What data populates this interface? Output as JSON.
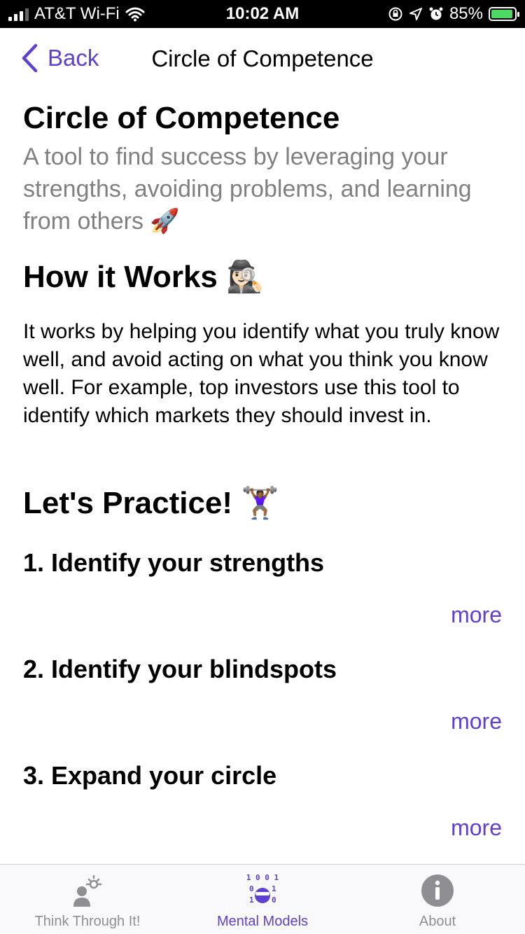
{
  "status_bar": {
    "carrier": "AT&T Wi-Fi",
    "time": "10:02 AM",
    "battery": "85%",
    "icons": [
      "signal-icon",
      "wifi-icon",
      "orientation-lock-icon",
      "location-icon",
      "alarm-icon",
      "battery-icon"
    ]
  },
  "nav": {
    "back_label": "Back",
    "title": "Circle of Competence"
  },
  "content": {
    "title": "Circle of Competence",
    "subtitle": "A tool to find success by leveraging your strengths, avoiding problems, and learning from others 🚀",
    "how_title": "How it Works 🕵🏻‍♀️",
    "how_body": "It works by helping you identify what you truly know well, and avoid acting on what you think you know well. For example, top investors use this tool to identify which markets they should invest in.",
    "practice_title": "Let's Practice! 🏋🏾‍♀️",
    "steps": [
      {
        "label": "1. Identify your strengths",
        "more": "more"
      },
      {
        "label": "2. Identify your blindspots",
        "more": "more"
      },
      {
        "label": "3. Expand your circle",
        "more": "more"
      }
    ]
  },
  "tabs": [
    {
      "label": "Think Through It!",
      "icon": "person-lightbulb-icon",
      "active": false
    },
    {
      "label": "Mental Models",
      "icon": "binary-mask-icon",
      "active": true
    },
    {
      "label": "About",
      "icon": "info-icon",
      "active": false
    }
  ],
  "colors": {
    "accent": "#6040d0",
    "subtitle_gray": "#808080",
    "tab_inactive": "#8e8e93"
  }
}
